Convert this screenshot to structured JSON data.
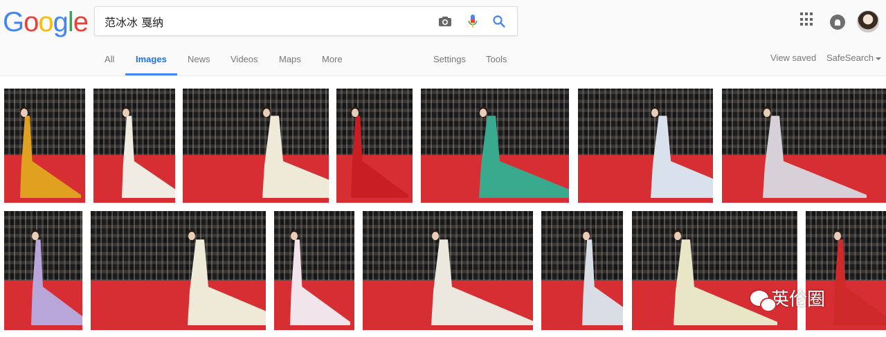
{
  "logo": {
    "letters": [
      "G",
      "o",
      "o",
      "g",
      "l",
      "e"
    ],
    "colors": [
      "#4285F4",
      "#EA4335",
      "#FBBC05",
      "#4285F4",
      "#34A853",
      "#EA4335"
    ]
  },
  "search": {
    "query": "范冰冰 戛纳",
    "camera_icon": "camera-icon",
    "mic_icon": "mic-icon",
    "search_icon": "search-icon"
  },
  "tabs": {
    "all": "All",
    "images": "Images",
    "news": "News",
    "videos": "Videos",
    "maps": "Maps",
    "more": "More",
    "settings": "Settings",
    "tools": "Tools"
  },
  "right_tools": {
    "view_saved": "View saved",
    "safesearch": "SafeSearch"
  },
  "header_icons": {
    "apps": "apps-grid-icon",
    "notifications": "notifications-icon",
    "account": "account-avatar"
  },
  "colors": {
    "accent": "#4285F4",
    "tab_active_text": "#1A73E8",
    "carpet": "#D72E34"
  },
  "results": [
    {
      "gown": "#e0a020"
    },
    {
      "gown": "#f0ece4"
    },
    {
      "gown": "#efe9d8"
    },
    {
      "gown": "#c81e24"
    },
    {
      "gown": "#3aaa8e"
    },
    {
      "gown": "#d9e2ec"
    },
    {
      "gown": "#d8d0d8"
    },
    {
      "gown": "#b8a6d8"
    },
    {
      "gown": "#efe9d8"
    },
    {
      "gown": "#f1e4ea"
    },
    {
      "gown": "#ece8e0"
    },
    {
      "gown": "#d9dde6"
    },
    {
      "gown": "#e9e6c8"
    },
    {
      "gown": "#cf2a2a"
    }
  ],
  "watermark": {
    "text": "英伦圈",
    "icon": "wechat-icon"
  }
}
